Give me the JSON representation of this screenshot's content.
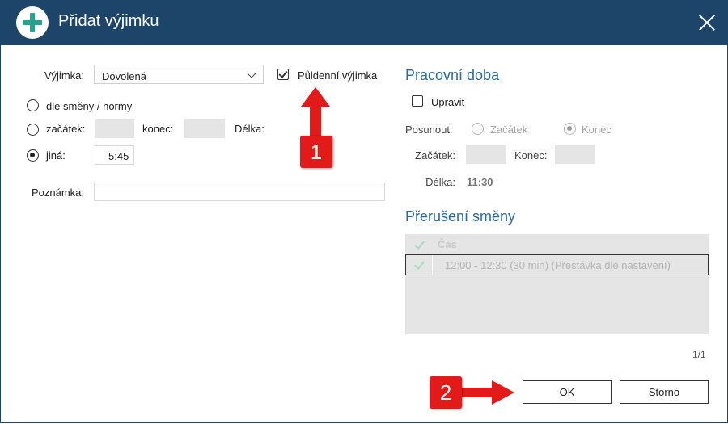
{
  "dialog": {
    "title": "Přidat výjimku",
    "title_icon": "plus-circle-icon",
    "close_icon": "close-icon"
  },
  "left": {
    "exception_label": "Výjimka:",
    "exception_value": "Dovolená",
    "half_day_label": "Půldenní výjimka",
    "half_day_checked": true,
    "radio_shift": "dle směny / normy",
    "radio_start": "začátek:",
    "end_label": "konec:",
    "length_label": "Délka:",
    "radio_other": "jiná:",
    "other_value": "5:45",
    "note_label": "Poznámka:",
    "note_value": ""
  },
  "right": {
    "work_title": "Pracovní doba",
    "edit_label": "Upravit",
    "shift_label": "Posunout:",
    "shift_start": "Začátek",
    "shift_end": "Konec",
    "start_label": "Začátek:",
    "end_label": "Konec:",
    "length_label": "Délka:",
    "length_value": "11:30",
    "break_title": "Přerušení směny",
    "table_header": "Čas",
    "table_rows": [
      "12:00 - 12:30 (30 min) (Přestávka dle nastavení)"
    ],
    "pager": "1/1"
  },
  "buttons": {
    "ok": "OK",
    "cancel": "Storno"
  },
  "annotations": {
    "one": "1",
    "two": "2",
    "color": "#e31a1a"
  },
  "colors": {
    "titlebar": "#1d4569",
    "accent_plus": "#23a48e",
    "section_title": "#2b6a99"
  }
}
